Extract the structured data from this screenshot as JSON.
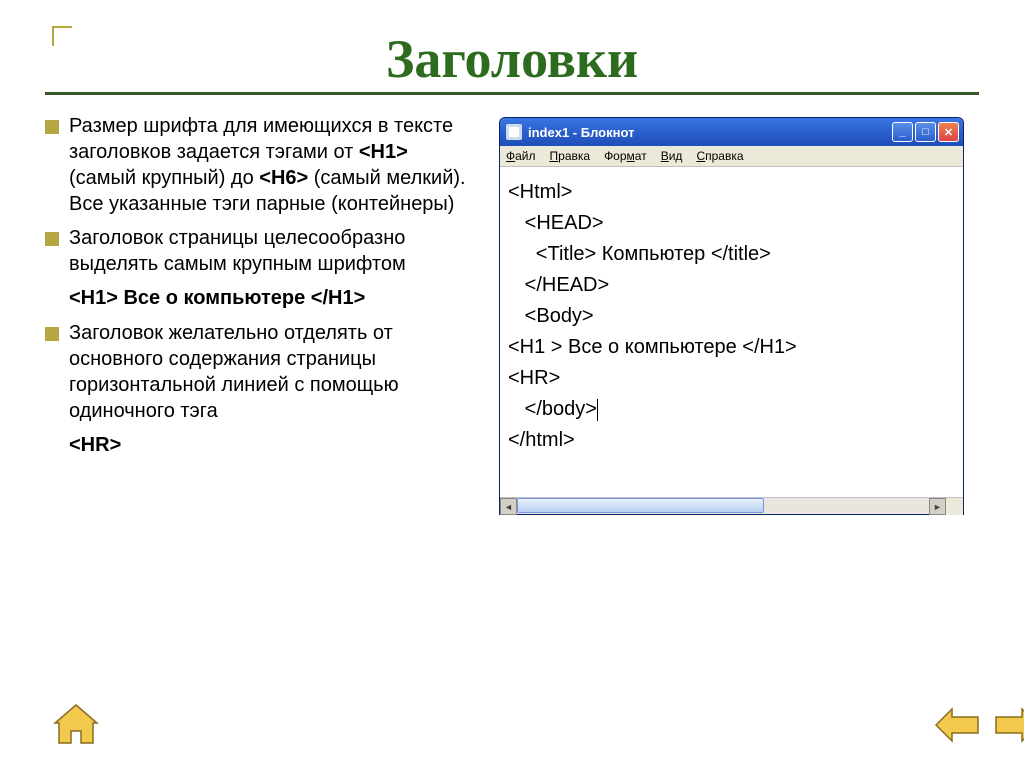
{
  "title": "Заголовки",
  "bullets": {
    "b1_pre": "Размер шрифта для имеющихся в тексте заголовков задается тэгами от ",
    "b1_tag1": "<H1>",
    "b1_mid1": " (самый крупный) до ",
    "b1_tag2": "<H6>",
    "b1_post": " (самый мелкий). Все указанные тэги парные (контейнеры)",
    "b2": "Заголовок страницы целесообразно выделять самым крупным шрифтом",
    "b2_code": "<H1> Все о компьютере </H1>",
    "b3": "Заголовок желательно отделять от основного содержания страницы горизонтальной линией с помощью одиночного тэга",
    "b3_code": "<HR>"
  },
  "notepad": {
    "title": "index1 - Блокнот",
    "menu": {
      "file": "Файл",
      "edit": "Правка",
      "format": "Формат",
      "view": "Вид",
      "help": "Справка"
    },
    "lines": {
      "l1": "<Html>",
      "l2": "   <HEAD>",
      "l3": "     <Title> Компьютер </title>",
      "l4": "   </HEAD>",
      "l5": "   <Body>",
      "l6": "<H1 > Все о компьютере </H1>",
      "l7": "<HR>",
      "l8_a": "   </body>",
      "l9": "</html>"
    }
  }
}
